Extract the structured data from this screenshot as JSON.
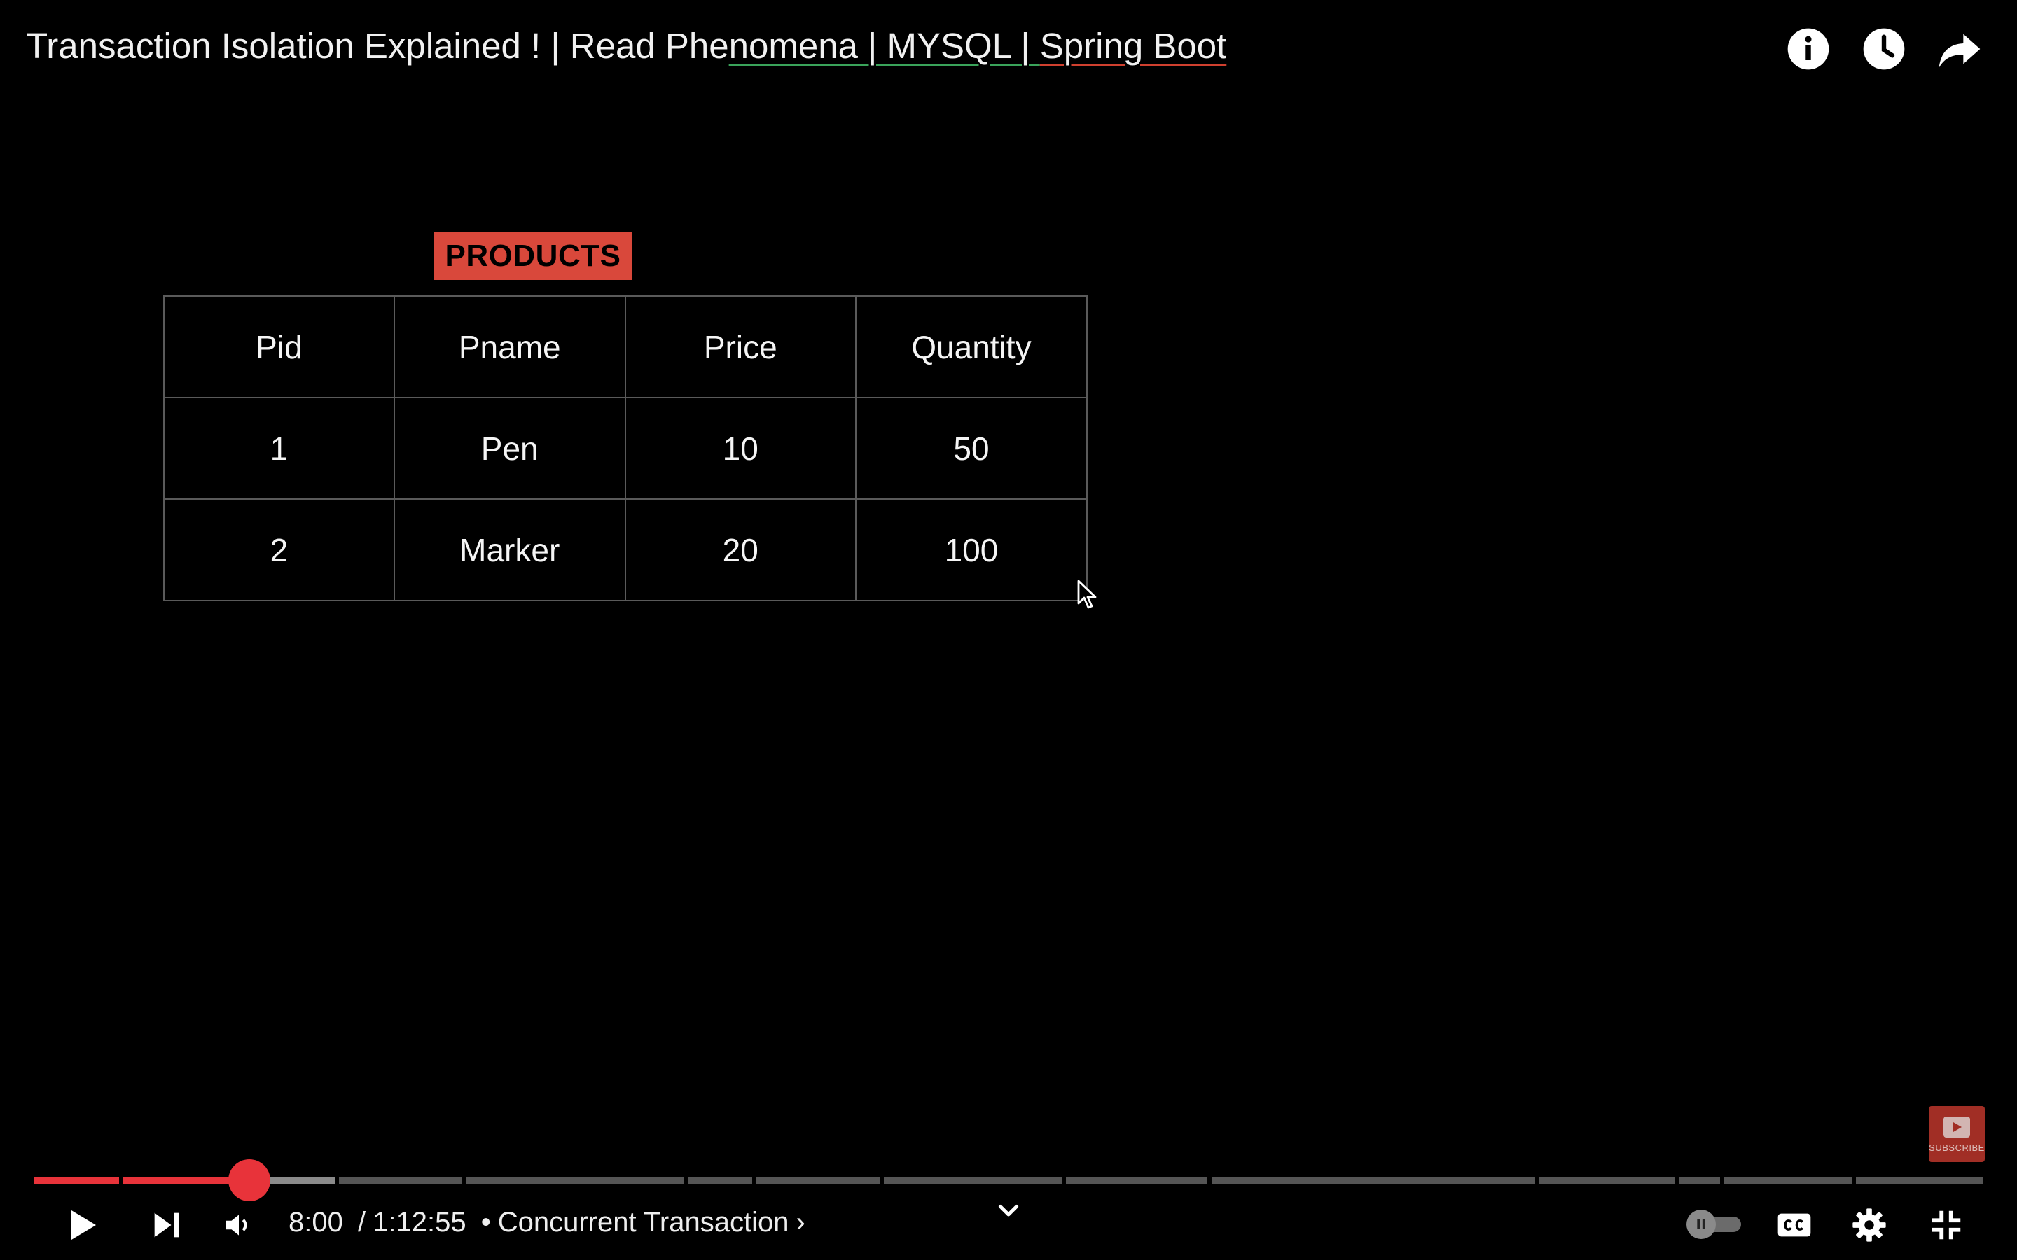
{
  "player": {
    "title_parts": [
      "Transaction Isolation Explained ! | Read Phe",
      "nomena | MYSQL | ",
      "Spring Boot"
    ],
    "top_icons": [
      "info-icon",
      "watch-later-icon",
      "share-icon"
    ]
  },
  "slide": {
    "table_title": "PRODUCTS",
    "columns": [
      "Pid",
      "Pname",
      "Price",
      "Quantity"
    ],
    "rows": [
      [
        "1",
        "Pen",
        "10",
        "50"
      ],
      [
        "2",
        "Marker",
        "20",
        "100"
      ]
    ],
    "accent_color": "#d9483b"
  },
  "watermark": {
    "label": "SUBSCRIBE"
  },
  "controls": {
    "current_time": "8:00",
    "duration": "1:12:55",
    "time_separator": "/",
    "chapter_bullet": "•",
    "chapter": "Concurrent Transaction",
    "chapter_arrow": "›",
    "progress_played_fraction": 0.1,
    "autoplay_knob": "II",
    "icons": [
      "play-icon",
      "next-icon",
      "volume-icon",
      "autoplay-toggle",
      "captions-icon",
      "settings-icon",
      "exit-fullscreen-icon"
    ]
  }
}
